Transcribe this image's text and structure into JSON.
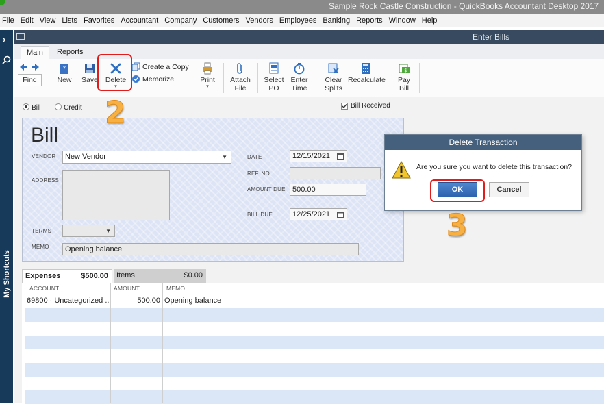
{
  "app": {
    "title": "Sample Rock Castle Construction  - QuickBooks Accountant Desktop 2017"
  },
  "menu": [
    "File",
    "Edit",
    "View",
    "Lists",
    "Favorites",
    "Accountant",
    "Company",
    "Customers",
    "Vendors",
    "Employees",
    "Banking",
    "Reports",
    "Window",
    "Help"
  ],
  "window": {
    "title": "Enter Bills"
  },
  "sidebar": {
    "label": "My Shortcuts"
  },
  "tabs": {
    "main": "Main",
    "reports": "Reports"
  },
  "toolbar": {
    "find": "Find",
    "new": "New",
    "save": "Save",
    "delete": "Delete",
    "create_copy": "Create a Copy",
    "memorize": "Memorize",
    "print": "Print",
    "attach": [
      "Attach",
      "File"
    ],
    "select_po": [
      "Select",
      "PO"
    ],
    "enter_time": [
      "Enter",
      "Time"
    ],
    "clear_splits": [
      "Clear",
      "Splits"
    ],
    "recalculate": "Recalculate",
    "pay_bill": [
      "Pay",
      "Bill"
    ]
  },
  "form": {
    "type_bill": "Bill",
    "type_credit": "Credit",
    "bill_received": "Bill Received",
    "heading": "Bill",
    "vendor_label": "VENDOR",
    "vendor_value": "New Vendor",
    "address_label": "ADDRESS",
    "terms_label": "TERMS",
    "memo_label": "MEMO",
    "memo_value": "Opening balance",
    "date_label": "DATE",
    "date_value": "12/15/2021",
    "ref_label": "REF. NO.",
    "ref_value": "",
    "amount_label": "AMOUNT DUE",
    "amount_value": "500.00",
    "billdue_label": "BILL DUE",
    "billdue_value": "12/25/2021"
  },
  "split_tabs": {
    "expenses_label": "Expenses",
    "expenses_total": "$500.00",
    "items_label": "Items",
    "items_total": "$0.00"
  },
  "grid": {
    "headers": {
      "account": "ACCOUNT",
      "amount": "AMOUNT",
      "memo": "MEMO"
    },
    "rows": [
      {
        "account": "69800 · Uncategorized ...",
        "amount": "500.00",
        "memo": "Opening balance"
      }
    ]
  },
  "dialog": {
    "title": "Delete Transaction",
    "message": "Are you sure you want to delete this transaction?",
    "ok": "OK",
    "cancel": "Cancel"
  },
  "annotations": {
    "step2": "2",
    "step3": "3"
  },
  "colors": {
    "annotation_box": "#e21b1b",
    "step_number": "#f6b043",
    "window_header": "#374a5f"
  }
}
